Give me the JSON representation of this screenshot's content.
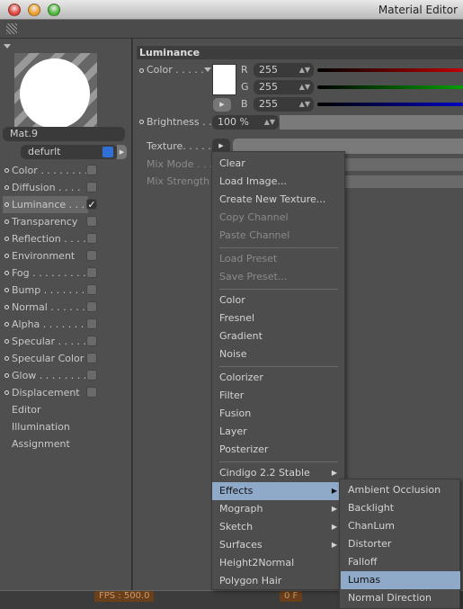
{
  "window": {
    "title": "Material Editor",
    "lights": [
      "#e0443c",
      "#f0a02a",
      "#4cb83a"
    ]
  },
  "material": {
    "name": "Mat.9",
    "layer": "defurlt",
    "layer_color": "#2f6fd6"
  },
  "channels": [
    {
      "label": "Color . . . . . . . .",
      "dot": true,
      "checked": false
    },
    {
      "label": "Diffusion  . . . .",
      "dot": true,
      "checked": false
    },
    {
      "label": "Luminance . . .",
      "dot": true,
      "checked": true,
      "active": true
    },
    {
      "label": "Transparency",
      "dot": true,
      "checked": false
    },
    {
      "label": "Reflection . . . .",
      "dot": true,
      "checked": false
    },
    {
      "label": "Environment",
      "dot": true,
      "checked": false
    },
    {
      "label": "Fog . . . . . . . . .",
      "dot": true,
      "checked": false
    },
    {
      "label": "Bump  . . . . . . .",
      "dot": true,
      "checked": false
    },
    {
      "label": "Normal . . . . . .",
      "dot": true,
      "checked": false
    },
    {
      "label": "Alpha . . . . . . . .",
      "dot": true,
      "checked": false
    },
    {
      "label": "Specular . . . . .",
      "dot": true,
      "checked": false
    },
    {
      "label": "Specular Color",
      "dot": true,
      "checked": false
    },
    {
      "label": "Glow . . . . . . . .",
      "dot": true,
      "checked": false
    },
    {
      "label": "Displacement",
      "dot": true,
      "checked": false
    },
    {
      "label": "Editor",
      "dot": false
    },
    {
      "label": "Illumination",
      "dot": false
    },
    {
      "label": "Assignment",
      "dot": false
    }
  ],
  "luminance": {
    "header": "Luminance",
    "color_label": "Color . . . . .",
    "rgb": [
      {
        "label": "R",
        "value": "255",
        "color": "#c00000"
      },
      {
        "label": "G",
        "value": "255",
        "color": "#00a000"
      },
      {
        "label": "B",
        "value": "255",
        "color": "#0000c0"
      }
    ],
    "brightness_label": "Brightness . .",
    "brightness": "100 %",
    "texture_label": "Texture. . . . .",
    "mix_mode_label": "Mix Mode . . .",
    "mix_strength_label": "Mix Strength"
  },
  "menu": {
    "items": [
      {
        "label": "Clear"
      },
      {
        "label": "Load Image..."
      },
      {
        "label": "Create New Texture..."
      },
      {
        "label": "Copy Channel",
        "disabled": true
      },
      {
        "label": "Paste Channel",
        "disabled": true
      },
      {
        "sep": true
      },
      {
        "label": "Load Preset",
        "disabled": true
      },
      {
        "label": "Save Preset...",
        "disabled": true
      },
      {
        "sep": true
      },
      {
        "label": "Color"
      },
      {
        "label": "Fresnel"
      },
      {
        "label": "Gradient"
      },
      {
        "label": "Noise"
      },
      {
        "sep": true
      },
      {
        "label": "Colorizer"
      },
      {
        "label": "Filter"
      },
      {
        "label": "Fusion"
      },
      {
        "label": "Layer"
      },
      {
        "label": "Posterizer"
      },
      {
        "sep": true
      },
      {
        "label": "Cindigo 2.2 Stable",
        "submenu": true
      },
      {
        "label": "Effects",
        "submenu": true,
        "selected": true
      },
      {
        "label": "Mograph",
        "submenu": true
      },
      {
        "label": "Sketch",
        "submenu": true
      },
      {
        "label": "Surfaces",
        "submenu": true
      },
      {
        "label": "Height2Normal"
      },
      {
        "label": "Polygon Hair"
      }
    ],
    "submenu": [
      {
        "label": "Ambient Occlusion"
      },
      {
        "label": "Backlight"
      },
      {
        "label": "ChanLum"
      },
      {
        "label": "Distorter"
      },
      {
        "label": "Falloff"
      },
      {
        "label": "Lumas",
        "selected": true
      },
      {
        "label": "Normal Direction"
      }
    ]
  },
  "status": {
    "fps": "FPS : 500.0",
    "frame": "0 F"
  }
}
